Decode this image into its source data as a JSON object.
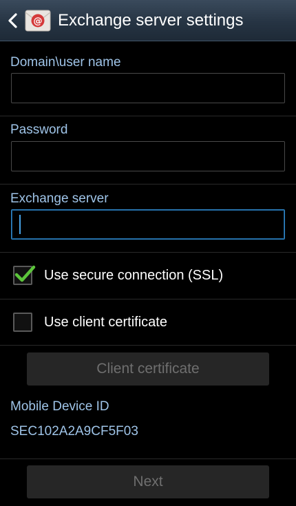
{
  "header": {
    "title": "Exchange server settings",
    "back_icon": "chevron-left-icon",
    "app_icon": "email-app-icon"
  },
  "form": {
    "domain_user": {
      "label": "Domain\\user name",
      "value": ""
    },
    "password": {
      "label": "Password",
      "value": ""
    },
    "exchange_server": {
      "label": "Exchange server",
      "value": "",
      "focused": true
    },
    "ssl": {
      "label": "Use secure connection (SSL)",
      "checked": true
    },
    "client_cert": {
      "label": "Use client certificate",
      "checked": false
    },
    "client_cert_button": {
      "label": "Client certificate",
      "enabled": false
    }
  },
  "device": {
    "label": "Mobile Device ID",
    "id": "SEC102A2A9CF5F03"
  },
  "footer": {
    "next_label": "Next",
    "next_enabled": false
  },
  "colors": {
    "accent_blue": "#2f86c6",
    "label_blue": "#9fc4e8",
    "check_green": "#5cc43b",
    "disabled_text": "#6f6f6f"
  }
}
